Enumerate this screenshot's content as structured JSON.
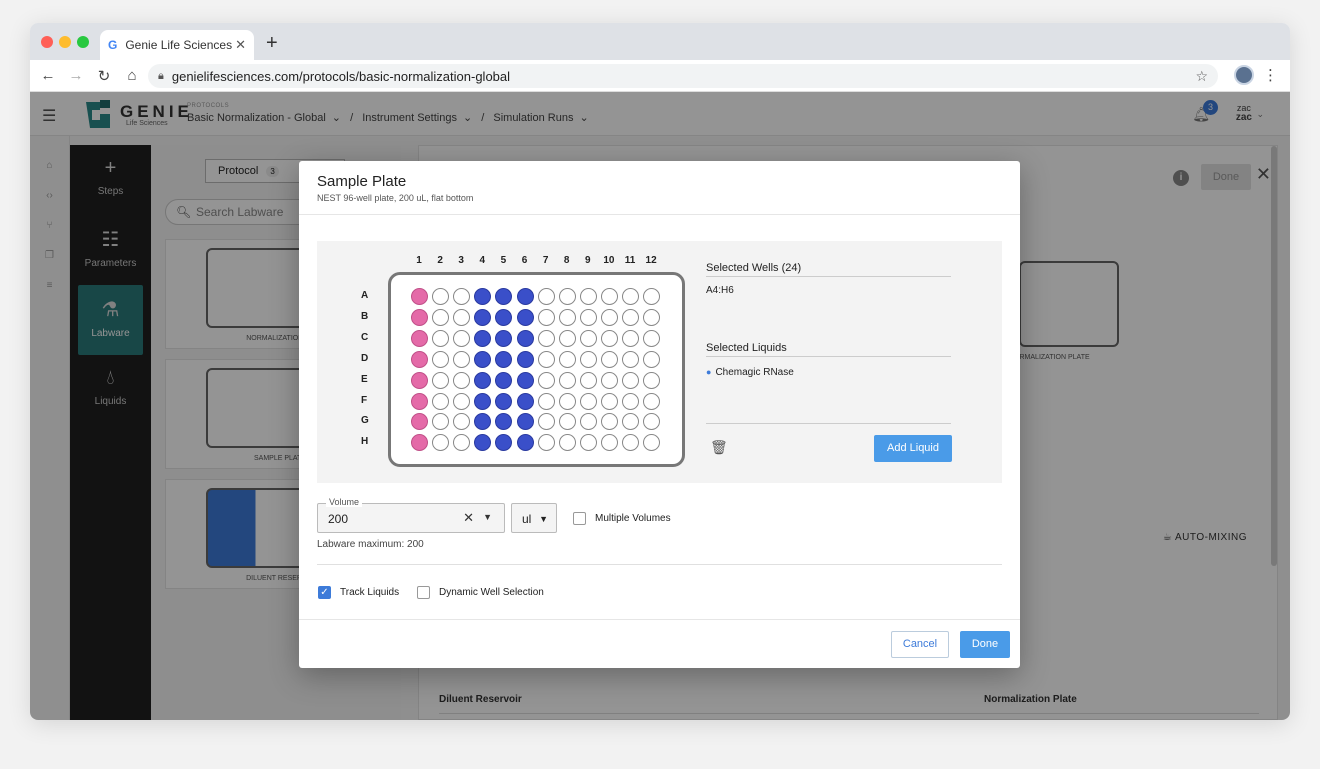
{
  "browser": {
    "tab_title": "Genie Life Sciences",
    "url": "genielifesciences.com/protocols/basic-normalization-global"
  },
  "app": {
    "logo_text": "GENIE",
    "logo_sub": "Life Sciences",
    "breadcrumb_label": "PROTOCOLS",
    "breadcrumbs": [
      "Basic Normalization - Global",
      "Instrument Settings",
      "Simulation Runs"
    ],
    "notification_count": "3",
    "user_top": "zac",
    "user_bottom": "zac"
  },
  "nav": {
    "items": [
      {
        "label": "Steps",
        "icon": "plus-icon"
      },
      {
        "label": "Parameters",
        "icon": "checklist-icon"
      },
      {
        "label": "Labware",
        "icon": "flask-icon",
        "active": true
      },
      {
        "label": "Liquids",
        "icon": "drop-icon"
      }
    ]
  },
  "labware_panel": {
    "segment_label": "Protocol",
    "segment_count": "3",
    "search_placeholder": "Search Labware",
    "cards": [
      "NORMALIZATION PL",
      "SAMPLE PLATE",
      "DILUENT RESERVOI"
    ]
  },
  "main_panel": {
    "done_label": "Done",
    "bg_plate_label": "NORMALIZATION PLATE",
    "automix_label": "AUTO-MIXING",
    "table_headers": [
      "Diluent Reservoir",
      "Normalization Plate"
    ]
  },
  "modal": {
    "title": "Sample Plate",
    "subtitle": "NEST 96-well plate, 200 uL, flat bottom",
    "columns": [
      "1",
      "2",
      "3",
      "4",
      "5",
      "6",
      "7",
      "8",
      "9",
      "10",
      "11",
      "12"
    ],
    "rows": [
      "A",
      "B",
      "C",
      "D",
      "E",
      "F",
      "G",
      "H"
    ],
    "pink_columns": [
      1
    ],
    "blue_columns": [
      4,
      5,
      6
    ],
    "colors": {
      "pink": "#e46aa8",
      "blue": "#3a4fc9",
      "accent": "#4a9be8"
    },
    "selected_wells_label": "Selected Wells (24)",
    "selected_wells_value": "A4:H6",
    "selected_liquids_label": "Selected Liquids",
    "selected_liquid": "Chemagic RNase",
    "add_liquid_label": "Add Liquid",
    "volume_label": "Volume",
    "volume_value": "200",
    "unit_value": "ul",
    "multiple_volumes_label": "Multiple Volumes",
    "max_label": "Labware maximum: 200",
    "track_liquids_label": "Track Liquids",
    "dynamic_well_label": "Dynamic Well Selection",
    "cancel_label": "Cancel",
    "done_label": "Done"
  }
}
